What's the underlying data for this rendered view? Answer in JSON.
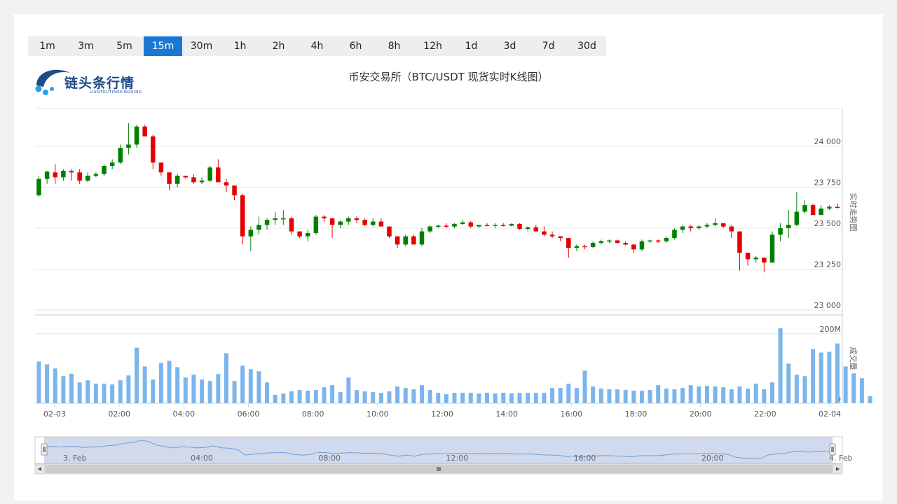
{
  "intervals": [
    "1m",
    "3m",
    "5m",
    "15m",
    "30m",
    "1h",
    "2h",
    "4h",
    "6h",
    "8h",
    "12h",
    "1d",
    "3d",
    "7d",
    "30d"
  ],
  "active_interval": "15m",
  "logo": {
    "name": "链头条行情",
    "sub": "LIANTOUTIAOXINGQING"
  },
  "colors": {
    "up": "#008000",
    "down": "#e60000",
    "volume": "#7cb5ec",
    "navigator": "#6a9fd8",
    "active_tab": "#1a78d2"
  },
  "chart_data": {
    "type": "candlestick",
    "title": "币安交易所（BTC/USDT 现货实时K线图）",
    "price_axis": {
      "label": "实时走势图",
      "ticks": [
        "24 000",
        "23 750",
        "23 500",
        "23 250",
        "23 000"
      ],
      "tick_values": [
        24000,
        23750,
        23500,
        23250,
        23000
      ],
      "ylim": [
        22970,
        24230
      ]
    },
    "volume_axis": {
      "label": "成交量",
      "ticks": [
        "200M",
        "0"
      ],
      "tick_values": [
        200,
        0
      ],
      "ylim": [
        0,
        250
      ],
      "unit": "M"
    },
    "x_ticks": [
      "02-03",
      "02:00",
      "04:00",
      "06:00",
      "08:00",
      "10:00",
      "12:00",
      "14:00",
      "16:00",
      "18:00",
      "20:00",
      "22:00",
      "02-04"
    ],
    "navigator_ticks": [
      "3. Feb",
      "04:00",
      "08:00",
      "12:00",
      "16:00",
      "20:00",
      "4. Feb"
    ],
    "candles": [
      [
        23700,
        23820,
        23690,
        23800
      ],
      [
        23800,
        23850,
        23770,
        23845
      ],
      [
        23840,
        23890,
        23770,
        23810
      ],
      [
        23810,
        23860,
        23790,
        23850
      ],
      [
        23850,
        23860,
        23790,
        23840
      ],
      [
        23840,
        23860,
        23770,
        23790
      ],
      [
        23790,
        23840,
        23780,
        23820
      ],
      [
        23820,
        23840,
        23810,
        23830
      ],
      [
        23830,
        23890,
        23820,
        23880
      ],
      [
        23880,
        23920,
        23860,
        23900
      ],
      [
        23900,
        24010,
        23890,
        23990
      ],
      [
        23990,
        24140,
        23950,
        24010
      ],
      [
        24010,
        24130,
        23990,
        24120
      ],
      [
        24120,
        24130,
        24060,
        24060
      ],
      [
        24060,
        24070,
        23860,
        23900
      ],
      [
        23900,
        23900,
        23820,
        23840
      ],
      [
        23840,
        23840,
        23730,
        23770
      ],
      [
        23770,
        23830,
        23750,
        23820
      ],
      [
        23820,
        23820,
        23800,
        23810
      ],
      [
        23810,
        23830,
        23770,
        23780
      ],
      [
        23780,
        23810,
        23770,
        23790
      ],
      [
        23790,
        23880,
        23780,
        23870
      ],
      [
        23870,
        23920,
        23800,
        23780
      ],
      [
        23780,
        23800,
        23720,
        23760
      ],
      [
        23760,
        23760,
        23670,
        23700
      ],
      [
        23700,
        23710,
        23400,
        23450
      ],
      [
        23450,
        23510,
        23360,
        23490
      ],
      [
        23490,
        23570,
        23460,
        23520
      ],
      [
        23520,
        23560,
        23490,
        23550
      ],
      [
        23550,
        23600,
        23520,
        23560
      ],
      [
        23560,
        23610,
        23520,
        23560
      ],
      [
        23560,
        23570,
        23460,
        23480
      ],
      [
        23480,
        23480,
        23440,
        23450
      ],
      [
        23450,
        23490,
        23420,
        23470
      ],
      [
        23470,
        23580,
        23460,
        23570
      ],
      [
        23570,
        23580,
        23540,
        23560
      ],
      [
        23560,
        23560,
        23440,
        23520
      ],
      [
        23520,
        23550,
        23500,
        23540
      ],
      [
        23540,
        23570,
        23520,
        23560
      ],
      [
        23560,
        23570,
        23530,
        23550
      ],
      [
        23550,
        23560,
        23510,
        23520
      ],
      [
        23520,
        23560,
        23510,
        23540
      ],
      [
        23540,
        23560,
        23520,
        23510
      ],
      [
        23510,
        23510,
        23440,
        23450
      ],
      [
        23450,
        23450,
        23380,
        23400
      ],
      [
        23400,
        23460,
        23390,
        23450
      ],
      [
        23450,
        23460,
        23400,
        23400
      ],
      [
        23400,
        23500,
        23390,
        23480
      ],
      [
        23480,
        23520,
        23470,
        23510
      ],
      [
        23510,
        23520,
        23500,
        23515
      ],
      [
        23515,
        23530,
        23500,
        23510
      ],
      [
        23510,
        23530,
        23500,
        23525
      ],
      [
        23525,
        23550,
        23520,
        23535
      ],
      [
        23535,
        23545,
        23500,
        23510
      ],
      [
        23510,
        23520,
        23500,
        23520
      ],
      [
        23520,
        23530,
        23510,
        23515
      ],
      [
        23515,
        23530,
        23500,
        23520
      ],
      [
        23520,
        23530,
        23510,
        23515
      ],
      [
        23515,
        23530,
        23510,
        23525
      ],
      [
        23525,
        23530,
        23490,
        23495
      ],
      [
        23495,
        23510,
        23480,
        23505
      ],
      [
        23505,
        23520,
        23480,
        23480
      ],
      [
        23480,
        23510,
        23450,
        23460
      ],
      [
        23460,
        23480,
        23440,
        23450
      ],
      [
        23450,
        23450,
        23420,
        23440
      ],
      [
        23440,
        23440,
        23320,
        23380
      ],
      [
        23380,
        23400,
        23360,
        23390
      ],
      [
        23390,
        23400,
        23370,
        23385
      ],
      [
        23385,
        23420,
        23380,
        23410
      ],
      [
        23410,
        23430,
        23400,
        23420
      ],
      [
        23420,
        23430,
        23410,
        23425
      ],
      [
        23425,
        23430,
        23405,
        23410
      ],
      [
        23410,
        23420,
        23395,
        23400
      ],
      [
        23400,
        23400,
        23350,
        23370
      ],
      [
        23370,
        23430,
        23360,
        23420
      ],
      [
        23420,
        23430,
        23410,
        23425
      ],
      [
        23425,
        23430,
        23410,
        23420
      ],
      [
        23420,
        23450,
        23410,
        23440
      ],
      [
        23440,
        23500,
        23430,
        23490
      ],
      [
        23490,
        23520,
        23470,
        23510
      ],
      [
        23510,
        23520,
        23480,
        23500
      ],
      [
        23500,
        23520,
        23490,
        23510
      ],
      [
        23510,
        23530,
        23500,
        23520
      ],
      [
        23520,
        23560,
        23510,
        23530
      ],
      [
        23530,
        23530,
        23500,
        23510
      ],
      [
        23510,
        23520,
        23440,
        23480
      ],
      [
        23480,
        23480,
        23240,
        23350
      ],
      [
        23350,
        23350,
        23270,
        23310
      ],
      [
        23310,
        23330,
        23290,
        23320
      ],
      [
        23320,
        23320,
        23230,
        23290
      ],
      [
        23290,
        23480,
        23290,
        23460
      ],
      [
        23460,
        23530,
        23420,
        23500
      ],
      [
        23500,
        23610,
        23440,
        23520
      ],
      [
        23520,
        23720,
        23510,
        23600
      ],
      [
        23600,
        23670,
        23590,
        23640
      ],
      [
        23640,
        23650,
        23580,
        23580
      ],
      [
        23580,
        23640,
        23580,
        23620
      ],
      [
        23620,
        23640,
        23610,
        23630
      ],
      [
        23630,
        23650,
        23620,
        23625
      ]
    ],
    "volume": [
      120,
      112,
      100,
      78,
      85,
      60,
      66,
      56,
      56,
      54,
      66,
      80,
      160,
      106,
      68,
      116,
      122,
      104,
      74,
      82,
      68,
      64,
      84,
      144,
      64,
      108,
      98,
      92,
      60,
      24,
      28,
      34,
      38,
      36,
      38,
      46,
      52,
      32,
      74,
      38,
      34,
      32,
      30,
      34,
      48,
      44,
      40,
      52,
      38,
      30,
      26,
      30,
      30,
      30,
      28,
      30,
      28,
      30,
      28,
      30,
      30,
      30,
      30,
      44,
      44,
      56,
      44,
      94,
      48,
      42,
      40,
      40,
      38,
      36,
      36,
      38,
      52,
      42,
      40,
      44,
      52,
      48,
      50,
      48,
      46,
      40,
      48,
      42,
      56,
      40,
      60,
      216,
      114,
      82,
      78,
      156,
      146,
      148,
      172,
      106,
      86,
      72,
      20
    ]
  }
}
